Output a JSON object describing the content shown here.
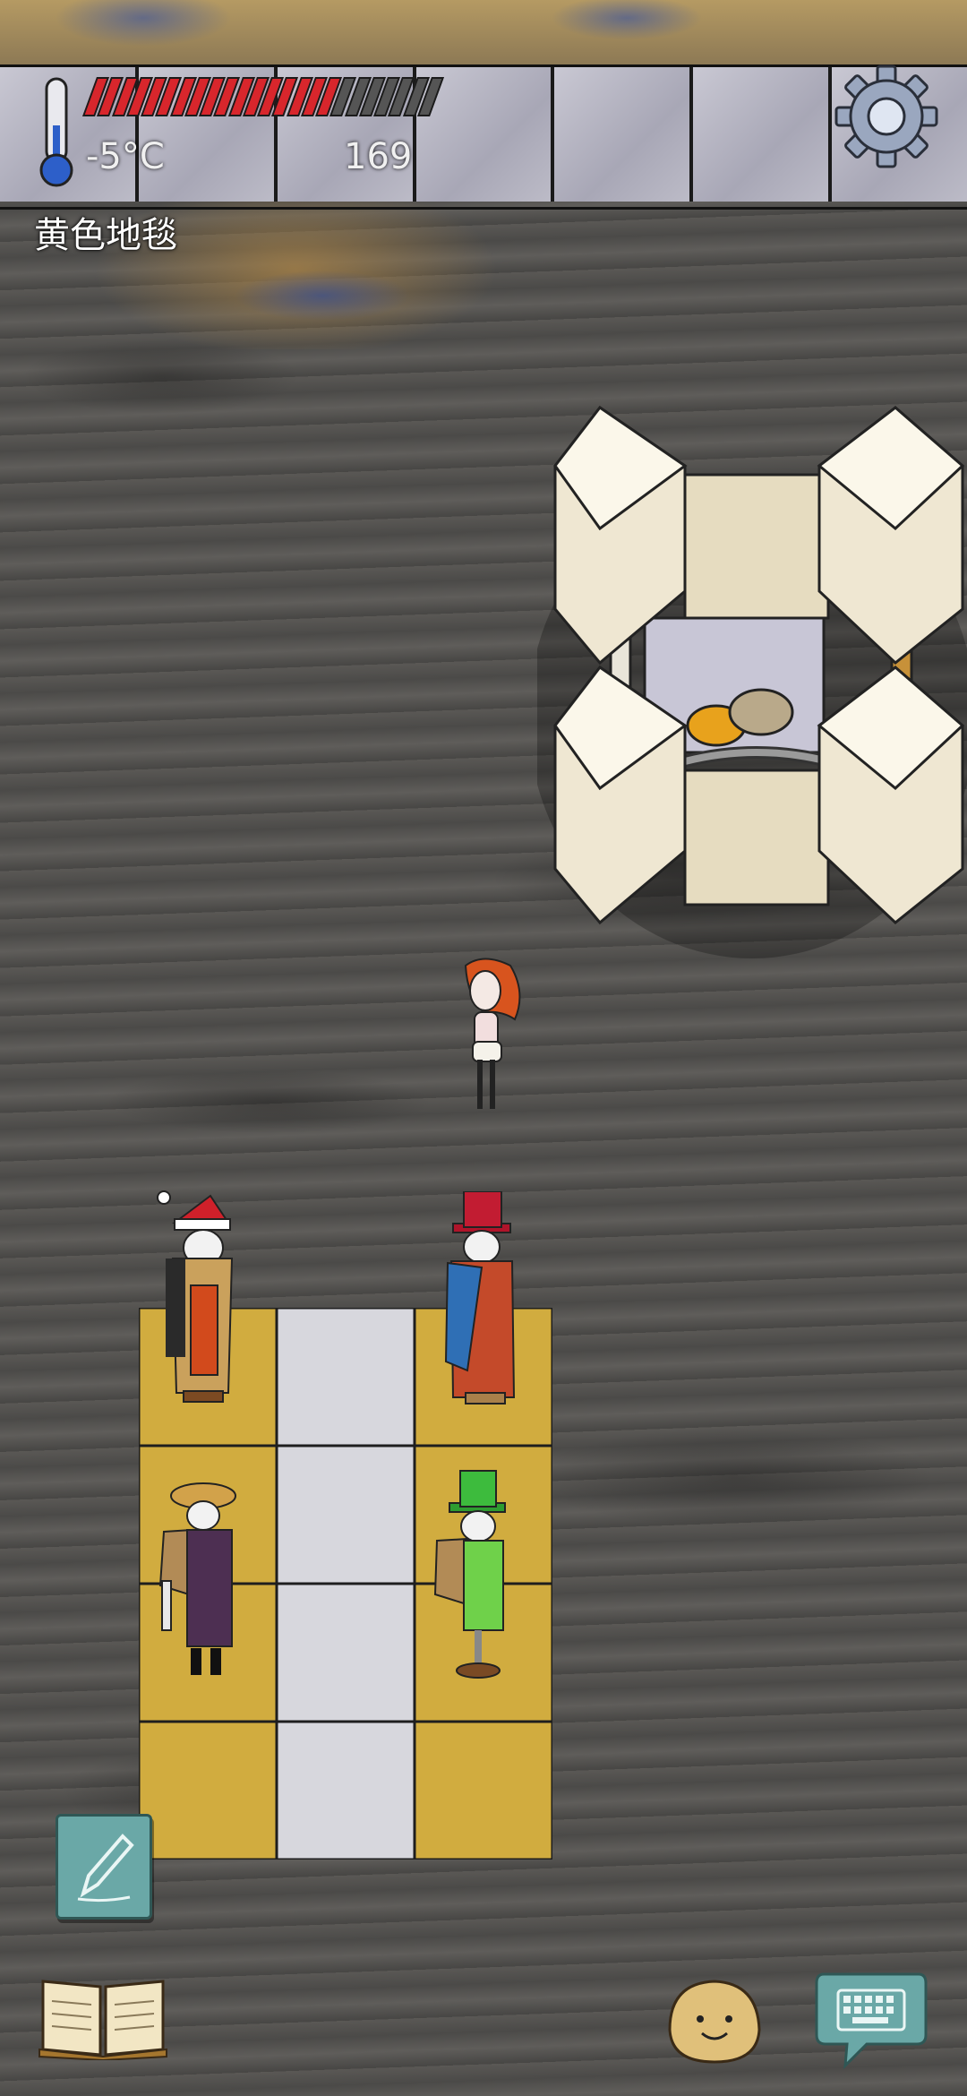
{
  "hud": {
    "temperature": "-5°C",
    "counter": "169",
    "health_fraction": 0.71,
    "health_color": "#d8262c",
    "health_empty_color": "#555555",
    "settings_icon": "gear-icon",
    "thermometer_icon": "thermometer-icon"
  },
  "location": {
    "label": "黄色地毯"
  },
  "controls": {
    "pen_icon": "pencil-icon",
    "book_icon": "open-book-icon",
    "emote_icon": "smiley-face-icon",
    "keyboard_icon": "keyboard-speech-icon"
  }
}
